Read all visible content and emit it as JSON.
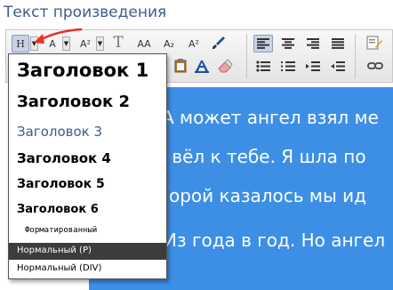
{
  "field_label": "Текст произведения",
  "toolbar": {
    "format_button_label": "H",
    "font_button_label": "A",
    "size_button_label": "A²",
    "text_format_label": "T",
    "uppercase_label": "AA",
    "subscript_label": "A₂",
    "superscript_label": "A²"
  },
  "format_menu": {
    "items": [
      "Заголовок 1",
      "Заголовок 2",
      "Заголовок 3",
      "Заголовок 4",
      "Заголовок 5",
      "Заголовок 6",
      "Форматированный",
      "Нормальный (P)",
      "Нормальный (DIV)"
    ],
    "selected": "Нормальный (P)"
  },
  "editor": {
    "lines": [
      "А может ангел взял ме",
      "И вёл к тебе. Я шла по",
      "орой казалось мы ид",
      "Из года в год. Но ангел"
    ]
  },
  "colors": {
    "editor_background": "#3d8fe6",
    "label_color": "#3f5b8c",
    "selected_item_background": "#3c3c3c",
    "arrow": "#e8302a"
  }
}
